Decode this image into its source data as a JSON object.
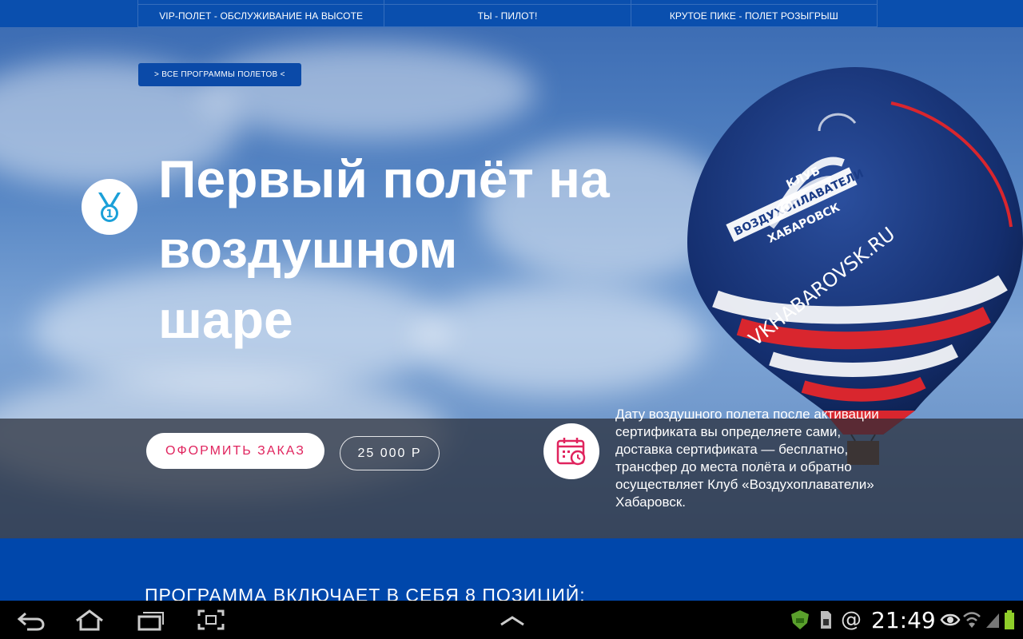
{
  "nav": {
    "top_row": [
      "",
      "",
      ""
    ],
    "items": [
      "VIP-ПОЛЕТ - ОБСЛУЖИВАНИЕ НА ВЫСОТЕ",
      "ТЫ - ПИЛОТ!",
      "КРУТОЕ ПИКЕ - ПОЛЕТ РОЗЫГРЫШ"
    ]
  },
  "hero": {
    "all_programs_label": "> ВСЕ ПРОГРАММЫ ПОЛЕТОВ <",
    "title_lines": [
      "Первый полёт на",
      "воздушном",
      "шаре"
    ],
    "medal_icon": "medal-1-icon"
  },
  "order": {
    "button_label": "ОФОРМИТЬ ЗАКАЗ",
    "price": "25 000 Р"
  },
  "info": {
    "icon": "calendar-clock-icon",
    "lines": [
      "Дату воздушного полета после активации",
      "сертификата вы определяете сами,",
      "доставка сертификата — бесплатно,",
      "трансфер до места полёта и обратно",
      "осуществляет Клуб «Воздухоплаватели»",
      "Хабаровск."
    ]
  },
  "section": {
    "heading": "ПРОГРАММА ВКЛЮЧАЕТ В СЕБЯ 8 ПОЗИЦИЙ:"
  },
  "balloon": {
    "text_club": "КЛУБ",
    "text_name": "ВОЗДУХОПЛАВАТЕЛИ",
    "text_city": "ХАБАРОВСК",
    "text_url": "VKHABAROVSK.RU"
  },
  "system_bar": {
    "time": "21:49",
    "nav_icons": [
      "back-icon",
      "home-icon",
      "recents-icon",
      "screenshot-icon",
      "menu-up-icon"
    ],
    "status_icons": [
      "shield-icon",
      "sd-card-icon",
      "at-icon",
      "eye-icon",
      "wifi-icon",
      "signal-icon",
      "battery-icon"
    ]
  },
  "colors": {
    "brand_blue": "#0047ab",
    "accent_red": "#e0245e"
  }
}
